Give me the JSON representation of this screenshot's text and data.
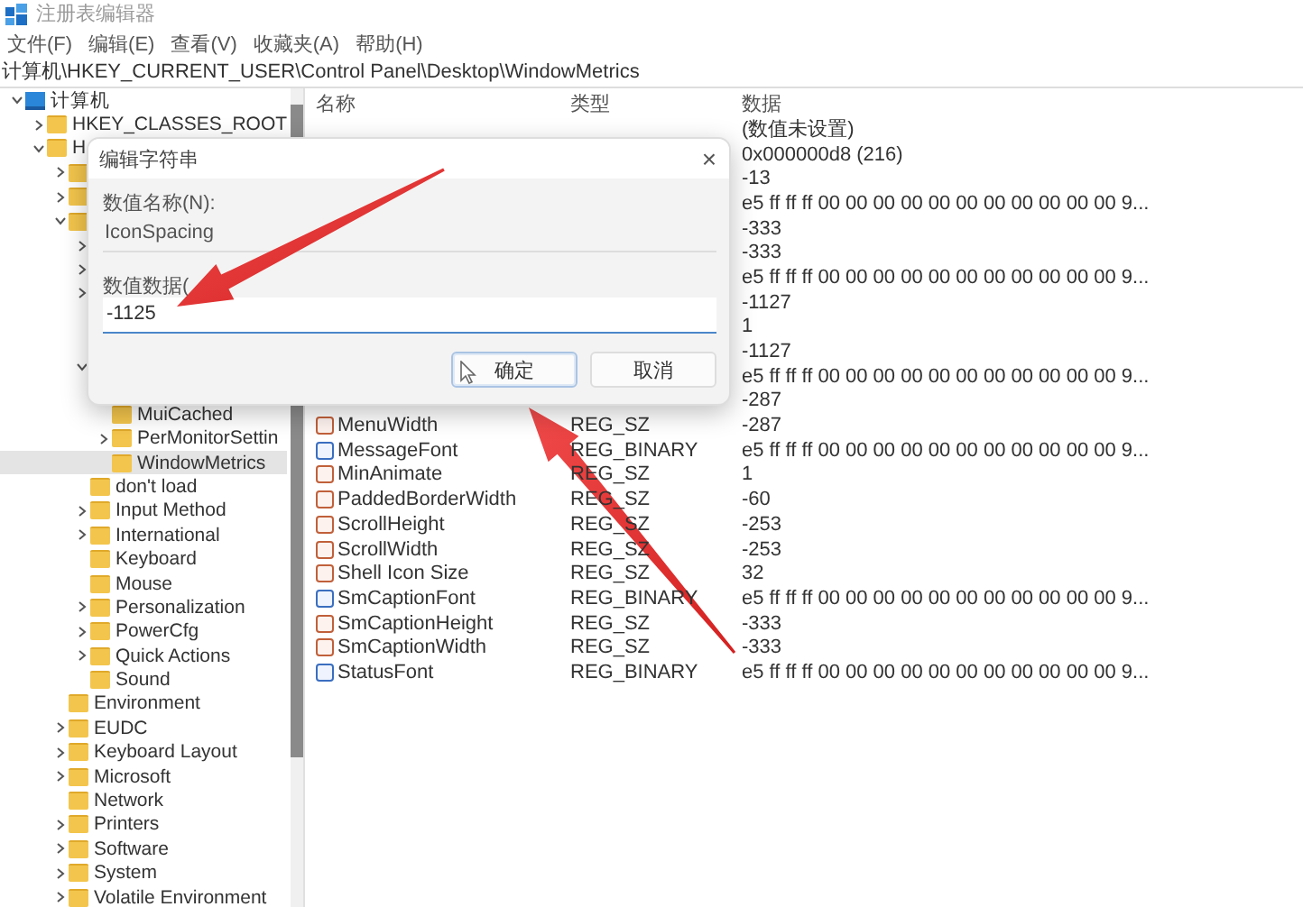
{
  "window": {
    "title": "注册表编辑器"
  },
  "menu": [
    "文件(F)",
    "编辑(E)",
    "查看(V)",
    "收藏夹(A)",
    "帮助(H)"
  ],
  "address": "计算机\\HKEY_CURRENT_USER\\Control Panel\\Desktop\\WindowMetrics",
  "tree": [
    {
      "kind": "computer",
      "label": "计算机",
      "expanded": true,
      "selected": false,
      "children": [
        {
          "label": "HKEY_CLASSES_ROOT",
          "expanded": false,
          "selected": false
        },
        {
          "label": "H",
          "expanded": true,
          "selected": false,
          "children": [
            {
              "expanded": false
            },
            {
              "expanded": false
            },
            {
              "expanded": true,
              "children": [
                {
                  "expanded": false
                },
                {
                  "expanded": false
                },
                {
                  "expanded": false
                },
                {
                  "expanded": true,
                  "children": [
                    {
                      "label": "MuiCached",
                      "selected": false
                    },
                    {
                      "label": "PerMonitorSettin",
                      "expanded": false,
                      "selected": false
                    },
                    {
                      "label": "WindowMetrics",
                      "selected": true
                    }
                  ]
                },
                {
                  "label": "don't load",
                  "selected": false
                },
                {
                  "label": "Input Method",
                  "expanded": false,
                  "selected": false
                },
                {
                  "label": "International",
                  "expanded": false,
                  "selected": false
                },
                {
                  "label": "Keyboard",
                  "selected": false
                },
                {
                  "label": "Mouse",
                  "selected": false
                },
                {
                  "label": "Personalization",
                  "expanded": false,
                  "selected": false
                },
                {
                  "label": "PowerCfg",
                  "expanded": false,
                  "selected": false
                },
                {
                  "label": "Quick Actions",
                  "expanded": false,
                  "selected": false
                },
                {
                  "label": "Sound",
                  "selected": false
                }
              ]
            },
            {
              "label": "Environment",
              "selected": false
            },
            {
              "label": "EUDC",
              "expanded": false,
              "selected": false
            },
            {
              "label": "Keyboard Layout",
              "expanded": false,
              "selected": false
            },
            {
              "label": "Microsoft",
              "expanded": false,
              "selected": false
            },
            {
              "label": "Network",
              "selected": false
            },
            {
              "label": "Printers",
              "expanded": false,
              "selected": false
            },
            {
              "label": "Software",
              "expanded": false,
              "selected": false
            },
            {
              "label": "System",
              "expanded": false,
              "selected": false
            },
            {
              "label": "Volatile Environment",
              "expanded": false,
              "selected": false
            }
          ]
        }
      ]
    }
  ],
  "table": {
    "columns": [
      "名称",
      "类型",
      "数据"
    ],
    "rows": [
      {
        "data": "(数值未设置)"
      },
      {
        "data": "0x000000d8 (216)"
      },
      {
        "data": "-13"
      },
      {
        "data": "e5 ff ff ff 00 00 00 00 00 00 00 00 00 00 00 9..."
      },
      {
        "data": "-333"
      },
      {
        "data": "-333"
      },
      {
        "data": "e5 ff ff ff 00 00 00 00 00 00 00 00 00 00 00 9..."
      },
      {
        "data": "-1127"
      },
      {
        "data": "1"
      },
      {
        "data": "-1127"
      },
      {
        "data": "e5 ff ff ff 00 00 00 00 00 00 00 00 00 00 00 9..."
      },
      {
        "data": "-287"
      },
      {
        "kind": "string",
        "name": "MenuWidth",
        "type": "REG_SZ",
        "data": "-287"
      },
      {
        "kind": "binary",
        "name": "MessageFont",
        "type": "REG_BINARY",
        "data": "e5 ff ff ff 00 00 00 00 00 00 00 00 00 00 00 9..."
      },
      {
        "kind": "string",
        "name": "MinAnimate",
        "type": "REG_SZ",
        "data": "1"
      },
      {
        "kind": "string",
        "name": "PaddedBorderWidth",
        "type": "REG_SZ",
        "data": "-60"
      },
      {
        "kind": "string",
        "name": "ScrollHeight",
        "type": "REG_SZ",
        "data": "-253"
      },
      {
        "kind": "string",
        "name": "ScrollWidth",
        "type": "REG_SZ",
        "data": "-253"
      },
      {
        "kind": "string",
        "name": "Shell Icon Size",
        "type": "REG_SZ",
        "data": "32"
      },
      {
        "kind": "binary",
        "name": "SmCaptionFont",
        "type": "REG_BINARY",
        "data": "e5 ff ff ff 00 00 00 00 00 00 00 00 00 00 00 9..."
      },
      {
        "kind": "string",
        "name": "SmCaptionHeight",
        "type": "REG_SZ",
        "data": "-333"
      },
      {
        "kind": "string",
        "name": "SmCaptionWidth",
        "type": "REG_SZ",
        "data": "-333"
      },
      {
        "kind": "binary",
        "name": "StatusFont",
        "type": "REG_BINARY",
        "data": "e5 ff ff ff 00 00 00 00 00 00 00 00 00 00 00 9..."
      }
    ]
  },
  "dialog": {
    "title": "编辑字符串",
    "close": "×",
    "name_label": "数值名称(N):",
    "name_value": "IconSpacing",
    "data_label": "数值数据(",
    "data_value": "-1125",
    "buttons": [
      {
        "label": "确定",
        "focused": true
      },
      {
        "label": "取消",
        "focused": false
      }
    ]
  },
  "annotations": [
    {
      "kind": "arrow"
    },
    {
      "kind": "arrow"
    }
  ]
}
